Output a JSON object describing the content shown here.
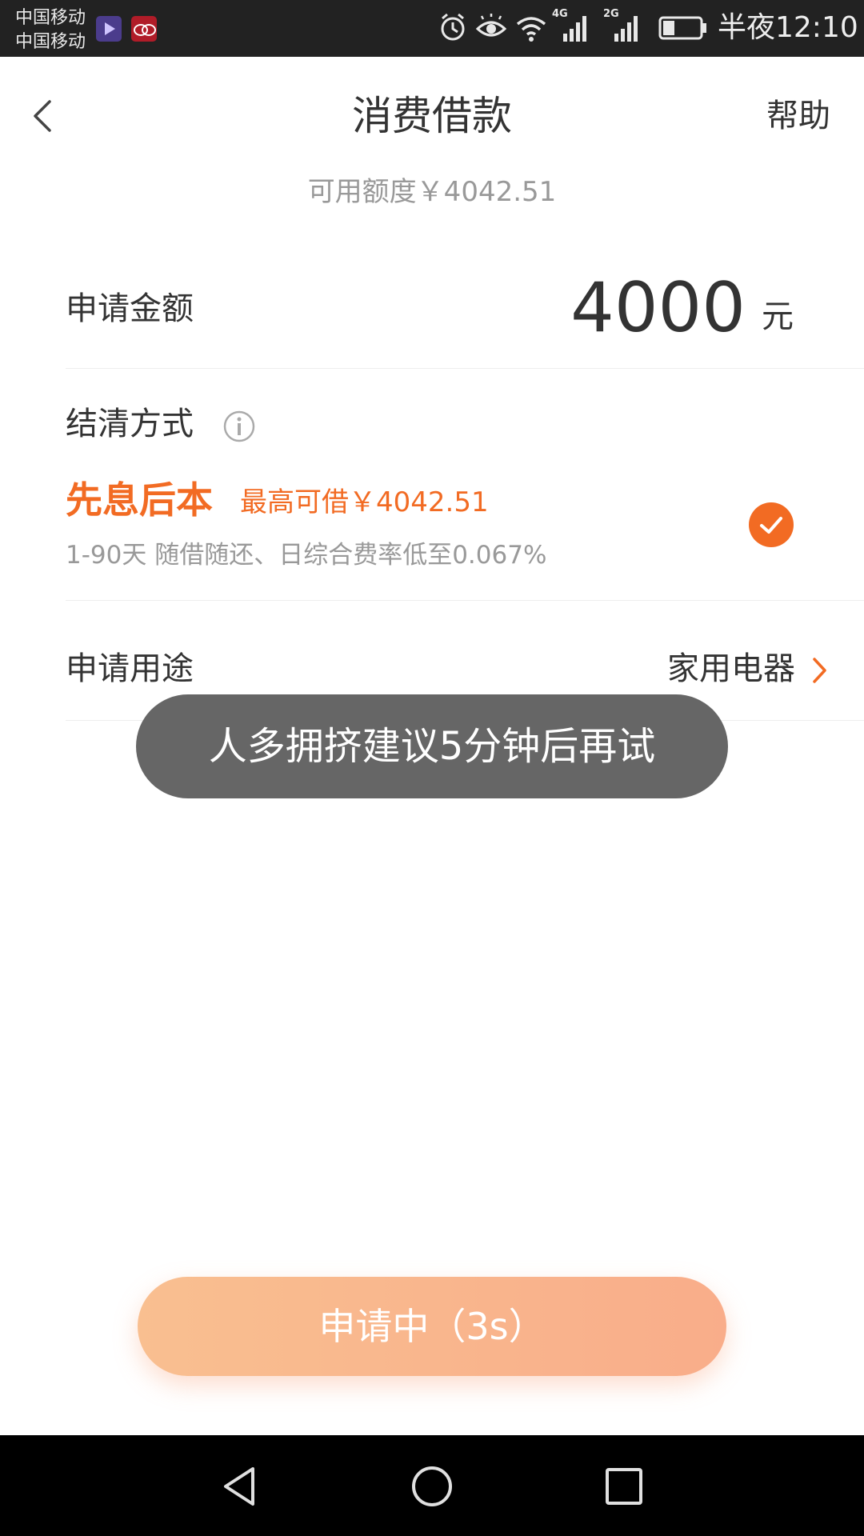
{
  "status_bar": {
    "carrier_1": "中国移动",
    "carrier_2": "中国移动",
    "network_1": "4G",
    "network_2": "2G",
    "time": "半夜12:10",
    "icons": [
      "video-app-icon",
      "unionpay-app-icon",
      "alarm-icon",
      "eye-comfort-icon",
      "wifi-icon",
      "signal-4g-icon",
      "signal-2g-icon",
      "battery-icon"
    ]
  },
  "header": {
    "title": "消费借款",
    "help_label": "帮助"
  },
  "credit": {
    "available_text": "可用额度￥4042.51"
  },
  "amount_row": {
    "label": "申请金额",
    "value": "4000",
    "unit": "元"
  },
  "repayment": {
    "label": "结清方式",
    "option_title": "先息后本",
    "max_borrow": "最高可借￥4042.51",
    "description": "1-90天 随借随还、日综合费率低至0.067%",
    "selected": true
  },
  "purpose_row": {
    "label": "申请用途",
    "value": "家用电器"
  },
  "toast": {
    "message": "人多拥挤建议5分钟后再试"
  },
  "submit": {
    "label": "申请中（3s）"
  },
  "colors": {
    "accent": "#f26b23",
    "button_gradient_start": "#f9bf90",
    "button_gradient_end": "#f9ad8a",
    "toast_bg": "#666666",
    "status_bar_bg": "#222222"
  }
}
